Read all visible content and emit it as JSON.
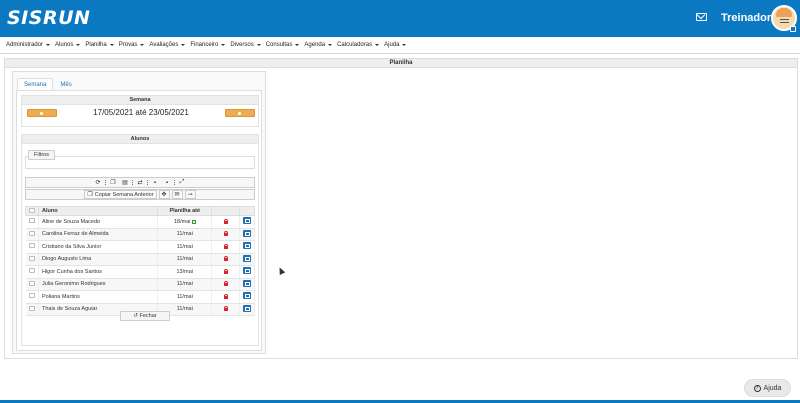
{
  "app": {
    "logo_text": "SISRUN",
    "user_name": "Treinador"
  },
  "menu": [
    {
      "label": "Administrador"
    },
    {
      "label": "Alunos"
    },
    {
      "label": "Planilha"
    },
    {
      "label": "Provas"
    },
    {
      "label": "Avaliações"
    },
    {
      "label": "Financeiro"
    },
    {
      "label": "Diversos"
    },
    {
      "label": "Consultas"
    },
    {
      "label": "Agenda"
    },
    {
      "label": "Calculadoras"
    },
    {
      "label": "Ajuda"
    }
  ],
  "panel": {
    "title": "Planilha"
  },
  "tabs": [
    {
      "label": "Semana",
      "active": true
    },
    {
      "label": "Mês",
      "active": false
    }
  ],
  "week": {
    "header": "Semana",
    "range": "17/05/2021 até 23/05/2021"
  },
  "students": {
    "header": "Alunos",
    "filter_label": "Filtros",
    "copy_label": "Copiar Semana Anterior",
    "columns": {
      "student": "Aluno",
      "sheet_until": "Planilha até"
    },
    "rows": [
      {
        "name": "Aline de Souza Macedo",
        "until": "18/mai",
        "checked": true
      },
      {
        "name": "Carolina Ferraz de Almeida",
        "until": "11/mai",
        "checked": false
      },
      {
        "name": "Cristiano da Silva Junior",
        "until": "11/mai",
        "checked": false
      },
      {
        "name": "Diogo Augusto Lima",
        "until": "11/mai",
        "checked": false
      },
      {
        "name": "Higor Cunha dos Santos",
        "until": "13/mai",
        "checked": false
      },
      {
        "name": "Julia Geronimo Rodrigues",
        "until": "11/mai",
        "checked": false
      },
      {
        "name": "Poliana Martins",
        "until": "11/mai",
        "checked": false
      },
      {
        "name": "Thais de Souza Aguiar",
        "until": "11/mai",
        "checked": false
      }
    ],
    "close_label": "Fechar"
  },
  "help": {
    "label": "Ajuda"
  },
  "colors": {
    "brand": "#0a79c2",
    "orange": "#f0ad4e",
    "lock": "#d9232d",
    "edit": "#1e6fb3"
  }
}
